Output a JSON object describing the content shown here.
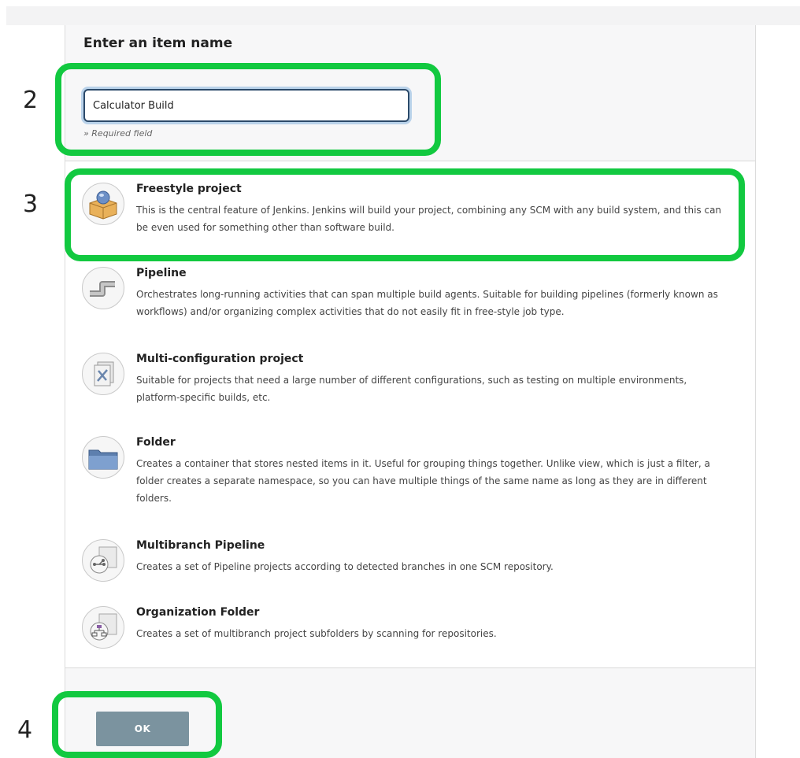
{
  "form": {
    "heading": "Enter an item name",
    "item_name_value": "Calculator Build",
    "required_hint": "» Required field",
    "ok_label": "OK"
  },
  "item_types": [
    {
      "title": "Freestyle project",
      "description": "This is the central feature of Jenkins. Jenkins will build your project, combining any SCM with any build system, and this can be even used for something other than software build.",
      "icon": "freestyle-box-icon"
    },
    {
      "title": "Pipeline",
      "description": "Orchestrates long-running activities that can span multiple build agents. Suitable for building pipelines (formerly known as workflows) and/or organizing complex activities that do not easily fit in free-style job type.",
      "icon": "pipe-icon"
    },
    {
      "title": "Multi-configuration project",
      "description": "Suitable for projects that need a large number of different configurations, such as testing on multiple environments, platform-specific builds, etc.",
      "icon": "multi-config-icon"
    },
    {
      "title": "Folder",
      "description": "Creates a container that stores nested items in it. Useful for grouping things together. Unlike view, which is just a filter, a folder creates a separate namespace, so you can have multiple things of the same name as long as they are in different folders.",
      "icon": "folder-icon"
    },
    {
      "title": "Multibranch Pipeline",
      "description": "Creates a set of Pipeline projects according to detected branches in one SCM repository.",
      "icon": "branch-icon"
    },
    {
      "title": "Organization Folder",
      "description": "Creates a set of multibranch project subfolders by scanning for repositories.",
      "icon": "org-folder-icon"
    }
  ],
  "annotations": {
    "step2": "2",
    "step3": "3",
    "step4": "4"
  },
  "colors": {
    "highlight": "#12c940",
    "ok_button": "#7b939f",
    "input_border": "#2c4a6a"
  }
}
